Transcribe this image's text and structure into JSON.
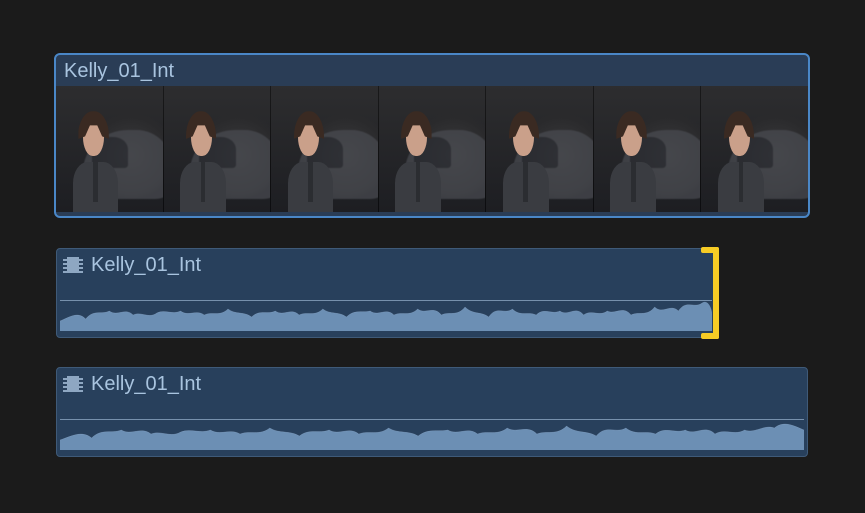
{
  "timeline": {
    "video_clip": {
      "title": "Kelly_01_Int",
      "frame_count": 7,
      "selected": true
    },
    "audio_clips": [
      {
        "id": "audio-1",
        "title": "Kelly_01_Int",
        "icon": "film-icon",
        "has_edit_point": true,
        "edit_point_side": "end",
        "relative_length": 0.872
      },
      {
        "id": "audio-2",
        "title": "Kelly_01_Int",
        "icon": "film-icon",
        "has_edit_point": false,
        "relative_length": 1.0
      }
    ]
  },
  "colors": {
    "clip_bg": "#28405c",
    "clip_border_selected": "#4a87c7",
    "text": "#a9c4df",
    "waveform": "#6c8fb4",
    "edit_point": "#f7cc25",
    "canvas_bg": "#1a1a1a"
  }
}
